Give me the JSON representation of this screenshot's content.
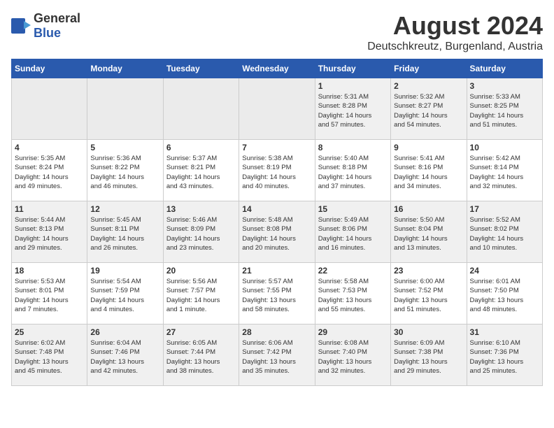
{
  "header": {
    "logo_general": "General",
    "logo_blue": "Blue",
    "month_year": "August 2024",
    "location": "Deutschkreutz, Burgenland, Austria"
  },
  "weekdays": [
    "Sunday",
    "Monday",
    "Tuesday",
    "Wednesday",
    "Thursday",
    "Friday",
    "Saturday"
  ],
  "weeks": [
    [
      {
        "day": "",
        "info": ""
      },
      {
        "day": "",
        "info": ""
      },
      {
        "day": "",
        "info": ""
      },
      {
        "day": "",
        "info": ""
      },
      {
        "day": "1",
        "info": "Sunrise: 5:31 AM\nSunset: 8:28 PM\nDaylight: 14 hours\nand 57 minutes."
      },
      {
        "day": "2",
        "info": "Sunrise: 5:32 AM\nSunset: 8:27 PM\nDaylight: 14 hours\nand 54 minutes."
      },
      {
        "day": "3",
        "info": "Sunrise: 5:33 AM\nSunset: 8:25 PM\nDaylight: 14 hours\nand 51 minutes."
      }
    ],
    [
      {
        "day": "4",
        "info": "Sunrise: 5:35 AM\nSunset: 8:24 PM\nDaylight: 14 hours\nand 49 minutes."
      },
      {
        "day": "5",
        "info": "Sunrise: 5:36 AM\nSunset: 8:22 PM\nDaylight: 14 hours\nand 46 minutes."
      },
      {
        "day": "6",
        "info": "Sunrise: 5:37 AM\nSunset: 8:21 PM\nDaylight: 14 hours\nand 43 minutes."
      },
      {
        "day": "7",
        "info": "Sunrise: 5:38 AM\nSunset: 8:19 PM\nDaylight: 14 hours\nand 40 minutes."
      },
      {
        "day": "8",
        "info": "Sunrise: 5:40 AM\nSunset: 8:18 PM\nDaylight: 14 hours\nand 37 minutes."
      },
      {
        "day": "9",
        "info": "Sunrise: 5:41 AM\nSunset: 8:16 PM\nDaylight: 14 hours\nand 34 minutes."
      },
      {
        "day": "10",
        "info": "Sunrise: 5:42 AM\nSunset: 8:14 PM\nDaylight: 14 hours\nand 32 minutes."
      }
    ],
    [
      {
        "day": "11",
        "info": "Sunrise: 5:44 AM\nSunset: 8:13 PM\nDaylight: 14 hours\nand 29 minutes."
      },
      {
        "day": "12",
        "info": "Sunrise: 5:45 AM\nSunset: 8:11 PM\nDaylight: 14 hours\nand 26 minutes."
      },
      {
        "day": "13",
        "info": "Sunrise: 5:46 AM\nSunset: 8:09 PM\nDaylight: 14 hours\nand 23 minutes."
      },
      {
        "day": "14",
        "info": "Sunrise: 5:48 AM\nSunset: 8:08 PM\nDaylight: 14 hours\nand 20 minutes."
      },
      {
        "day": "15",
        "info": "Sunrise: 5:49 AM\nSunset: 8:06 PM\nDaylight: 14 hours\nand 16 minutes."
      },
      {
        "day": "16",
        "info": "Sunrise: 5:50 AM\nSunset: 8:04 PM\nDaylight: 14 hours\nand 13 minutes."
      },
      {
        "day": "17",
        "info": "Sunrise: 5:52 AM\nSunset: 8:02 PM\nDaylight: 14 hours\nand 10 minutes."
      }
    ],
    [
      {
        "day": "18",
        "info": "Sunrise: 5:53 AM\nSunset: 8:01 PM\nDaylight: 14 hours\nand 7 minutes."
      },
      {
        "day": "19",
        "info": "Sunrise: 5:54 AM\nSunset: 7:59 PM\nDaylight: 14 hours\nand 4 minutes."
      },
      {
        "day": "20",
        "info": "Sunrise: 5:56 AM\nSunset: 7:57 PM\nDaylight: 14 hours\nand 1 minute."
      },
      {
        "day": "21",
        "info": "Sunrise: 5:57 AM\nSunset: 7:55 PM\nDaylight: 13 hours\nand 58 minutes."
      },
      {
        "day": "22",
        "info": "Sunrise: 5:58 AM\nSunset: 7:53 PM\nDaylight: 13 hours\nand 55 minutes."
      },
      {
        "day": "23",
        "info": "Sunrise: 6:00 AM\nSunset: 7:52 PM\nDaylight: 13 hours\nand 51 minutes."
      },
      {
        "day": "24",
        "info": "Sunrise: 6:01 AM\nSunset: 7:50 PM\nDaylight: 13 hours\nand 48 minutes."
      }
    ],
    [
      {
        "day": "25",
        "info": "Sunrise: 6:02 AM\nSunset: 7:48 PM\nDaylight: 13 hours\nand 45 minutes."
      },
      {
        "day": "26",
        "info": "Sunrise: 6:04 AM\nSunset: 7:46 PM\nDaylight: 13 hours\nand 42 minutes."
      },
      {
        "day": "27",
        "info": "Sunrise: 6:05 AM\nSunset: 7:44 PM\nDaylight: 13 hours\nand 38 minutes."
      },
      {
        "day": "28",
        "info": "Sunrise: 6:06 AM\nSunset: 7:42 PM\nDaylight: 13 hours\nand 35 minutes."
      },
      {
        "day": "29",
        "info": "Sunrise: 6:08 AM\nSunset: 7:40 PM\nDaylight: 13 hours\nand 32 minutes."
      },
      {
        "day": "30",
        "info": "Sunrise: 6:09 AM\nSunset: 7:38 PM\nDaylight: 13 hours\nand 29 minutes."
      },
      {
        "day": "31",
        "info": "Sunrise: 6:10 AM\nSunset: 7:36 PM\nDaylight: 13 hours\nand 25 minutes."
      }
    ]
  ]
}
